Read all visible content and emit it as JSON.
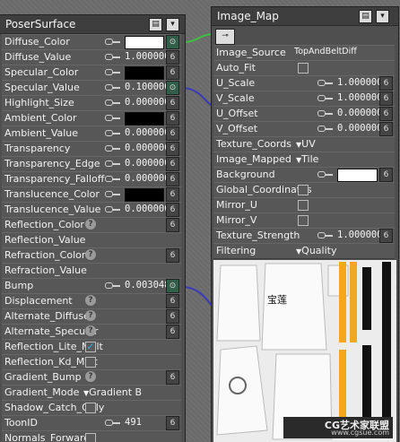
{
  "poser_node": {
    "title": "PoserSurface",
    "rows": [
      {
        "label": "Diffuse_Color",
        "kind": "color",
        "color": "#ffffff",
        "connected": true
      },
      {
        "label": "Diffuse_Value",
        "kind": "value",
        "value": "1.000000"
      },
      {
        "label": "Specular_Color",
        "kind": "color",
        "color": "#000000"
      },
      {
        "label": "Specular_Value",
        "kind": "value",
        "value": "0.100000",
        "connected": true
      },
      {
        "label": "Highlight_Size",
        "kind": "value",
        "value": "0.000000"
      },
      {
        "label": "Ambient_Color",
        "kind": "color",
        "color": "#000000"
      },
      {
        "label": "Ambient_Value",
        "kind": "value",
        "value": "0.000000"
      },
      {
        "label": "Transparency",
        "kind": "value",
        "value": "0.000000"
      },
      {
        "label": "Transparency_Edge",
        "kind": "value",
        "value": "0.000000"
      },
      {
        "label": "Transparency_Falloff",
        "kind": "value",
        "value": "0.000000"
      },
      {
        "label": "Translucence_Color",
        "kind": "color",
        "color": "#000000"
      },
      {
        "label": "Translucence_Value",
        "kind": "value",
        "value": "0.000000"
      },
      {
        "label": "Reflection_Color",
        "kind": "help"
      },
      {
        "label": "Reflection_Value",
        "kind": "plain"
      },
      {
        "label": "Refraction_Color",
        "kind": "help"
      },
      {
        "label": "Refraction_Value",
        "kind": "plain"
      },
      {
        "label": "Bump",
        "kind": "value",
        "value": "0.003048",
        "connected": true
      },
      {
        "label": "Displacement",
        "kind": "help"
      },
      {
        "label": "Alternate_Diffuse",
        "kind": "help"
      },
      {
        "label": "Alternate_Specular",
        "kind": "help"
      },
      {
        "label": "Reflection_Lite_Mult",
        "kind": "check",
        "checked": true
      },
      {
        "label": "Reflection_Kd_Mult",
        "kind": "check",
        "checked": false
      },
      {
        "label": "Gradient_Bump",
        "kind": "help"
      },
      {
        "label": "Gradient_Mode",
        "kind": "dropdown",
        "value": "Gradient B"
      },
      {
        "label": "Shadow_Catch_Only",
        "kind": "check",
        "checked": false
      },
      {
        "label": "ToonID",
        "kind": "value",
        "value": "491"
      },
      {
        "label": "Normals_Forward",
        "kind": "check",
        "checked": false
      }
    ]
  },
  "image_node": {
    "title": "Image_Map",
    "rows": [
      {
        "label": "Image_Source",
        "kind": "text",
        "value": "TopAndBeltDiff"
      },
      {
        "label": "Auto_Fit",
        "kind": "check",
        "checked": false
      },
      {
        "label": "U_Scale",
        "kind": "value",
        "value": "1.000000"
      },
      {
        "label": "V_Scale",
        "kind": "value",
        "value": "1.000000"
      },
      {
        "label": "U_Offset",
        "kind": "value",
        "value": "0.000000"
      },
      {
        "label": "V_Offset",
        "kind": "value",
        "value": "0.000000"
      },
      {
        "label": "Texture_Coords",
        "kind": "dropdown",
        "value": "UV"
      },
      {
        "label": "Image_Mapped",
        "kind": "dropdown",
        "value": "Tile"
      },
      {
        "label": "Background",
        "kind": "color",
        "color": "#ffffff"
      },
      {
        "label": "Global_Coordinates",
        "kind": "check",
        "checked": false
      },
      {
        "label": "Mirror_U",
        "kind": "check",
        "checked": false
      },
      {
        "label": "Mirror_V",
        "kind": "check",
        "checked": false
      },
      {
        "label": "Texture_Strength",
        "kind": "value",
        "value": "1.000000"
      },
      {
        "label": "Filtering",
        "kind": "dropdown",
        "value": "Quality"
      }
    ]
  },
  "preview_glyph": "宝莲",
  "watermark": {
    "line1": "CG艺术家联盟",
    "line2": "www.cgsue.com"
  }
}
